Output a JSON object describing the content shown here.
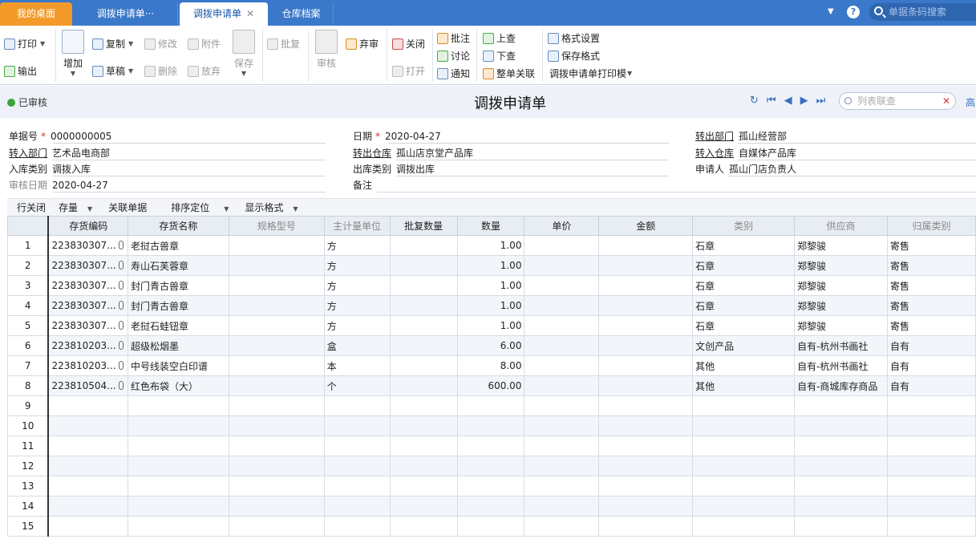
{
  "tabs": {
    "home": "我的桌面",
    "t1": "调拨申请单···",
    "t2": "调拨申请单",
    "t3": "仓库档案",
    "search_placeholder": "单据条码搜索"
  },
  "toolbar": {
    "print": "打印",
    "export": "输出",
    "add": "增加",
    "copy": "复制",
    "draft": "草稿",
    "modify": "修改",
    "delete": "删除",
    "attach": "附件",
    "abandon": "放弃",
    "save": "保存",
    "batch_reply": "批复",
    "audit": "审核",
    "unaudit": "弃审",
    "close": "关闭",
    "open": "打开",
    "annotate": "批注",
    "discuss": "讨论",
    "notify": "通知",
    "prev_query": "上查",
    "next_query": "下查",
    "link_all": "整单关联",
    "format_setting": "格式设置",
    "save_format": "保存格式",
    "print_template": "调拨申请单打印模"
  },
  "header": {
    "status": "已审核",
    "title": "调拨申请单",
    "link_search_placeholder": "列表联查",
    "more": "高"
  },
  "form": {
    "doc_no_label": "单据号",
    "doc_no": "0000000005",
    "date_label": "日期",
    "date": "2020-04-27",
    "out_dept_label": "转出部门",
    "out_dept": "孤山经营部",
    "in_dept_label": "转入部门",
    "in_dept": "艺术品电商部",
    "out_wh_label": "转出仓库",
    "out_wh": "孤山店京堂产品库",
    "in_wh_label": "转入仓库",
    "in_wh": "自媒体产品库",
    "in_type_label": "入库类别",
    "in_type": "调拨入库",
    "out_type_label": "出库类别",
    "out_type": "调拨出库",
    "applicant_label": "申请人",
    "applicant": "孤山门店负责人",
    "audit_date_label": "审核日期",
    "audit_date": "2020-04-27",
    "remark_label": "备注",
    "remark": ""
  },
  "gridbar": {
    "row_close": "行关闭",
    "stock": "存量",
    "related": "关联单据",
    "sort": "排序定位",
    "display": "显示格式"
  },
  "columns": [
    "存货编码",
    "存货名称",
    "规格型号",
    "主计量单位",
    "批复数量",
    "数量",
    "单价",
    "金额",
    "类别",
    "供应商",
    "归属类别"
  ],
  "rows": [
    {
      "n": "1",
      "code": "223830307...",
      "name": "老挝古兽章",
      "spec": "",
      "unit": "方",
      "approved": "",
      "qty": "1.00",
      "price": "",
      "amount": "",
      "cat": "石章",
      "supplier": "郑黎骏",
      "belong": "寄售"
    },
    {
      "n": "2",
      "code": "223830307...",
      "name": "寿山石芙蓉章",
      "spec": "",
      "unit": "方",
      "approved": "",
      "qty": "1.00",
      "price": "",
      "amount": "",
      "cat": "石章",
      "supplier": "郑黎骏",
      "belong": "寄售"
    },
    {
      "n": "3",
      "code": "223830307...",
      "name": "封门青古兽章",
      "spec": "",
      "unit": "方",
      "approved": "",
      "qty": "1.00",
      "price": "",
      "amount": "",
      "cat": "石章",
      "supplier": "郑黎骏",
      "belong": "寄售"
    },
    {
      "n": "4",
      "code": "223830307...",
      "name": "封门青古兽章",
      "spec": "",
      "unit": "方",
      "approved": "",
      "qty": "1.00",
      "price": "",
      "amount": "",
      "cat": "石章",
      "supplier": "郑黎骏",
      "belong": "寄售"
    },
    {
      "n": "5",
      "code": "223830307...",
      "name": "老挝石蛙钮章",
      "spec": "",
      "unit": "方",
      "approved": "",
      "qty": "1.00",
      "price": "",
      "amount": "",
      "cat": "石章",
      "supplier": "郑黎骏",
      "belong": "寄售"
    },
    {
      "n": "6",
      "code": "223810203...",
      "name": "超级松烟墨",
      "spec": "",
      "unit": "盒",
      "approved": "",
      "qty": "6.00",
      "price": "",
      "amount": "",
      "cat": "文创产品",
      "supplier": "自有-杭州书画社",
      "belong": "自有"
    },
    {
      "n": "7",
      "code": "223810203...",
      "name": "中号线装空白印谱",
      "spec": "",
      "unit": "本",
      "approved": "",
      "qty": "8.00",
      "price": "",
      "amount": "",
      "cat": "其他",
      "supplier": "自有-杭州书画社",
      "belong": "自有"
    },
    {
      "n": "8",
      "code": "223810504...",
      "name": "红色布袋（大）",
      "spec": "",
      "unit": "个",
      "approved": "",
      "qty": "600.00",
      "price": "",
      "amount": "",
      "cat": "其他",
      "supplier": "自有-商城库存商品",
      "belong": "自有"
    },
    {
      "n": "9"
    },
    {
      "n": "10"
    },
    {
      "n": "11"
    },
    {
      "n": "12"
    },
    {
      "n": "13"
    },
    {
      "n": "14"
    },
    {
      "n": "15"
    }
  ]
}
